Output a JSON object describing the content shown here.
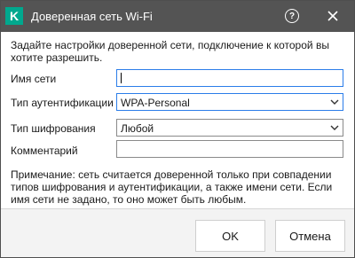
{
  "window": {
    "title": "Доверенная сеть Wi-Fi",
    "logo_letter": "K",
    "help_symbol": "?",
    "accent_color": "#00a88e",
    "titlebar_color": "#545454"
  },
  "intro_text": "Задайте настройки доверенной сети, подключение к которой вы хотите разрешить.",
  "form": {
    "network_name": {
      "label": "Имя сети",
      "value": "",
      "placeholder": ""
    },
    "auth_type": {
      "label": "Тип аутентификации",
      "value": "WPA-Personal"
    },
    "encryption_type": {
      "label": "Тип шифрования",
      "value": "Любой"
    },
    "comment": {
      "label": "Комментарий",
      "value": "",
      "placeholder": ""
    }
  },
  "note_text": "Примечание: сеть считается доверенной только при совпадении типов шифрования и аутентификации, а также имени сети. Если имя сети не задано, то оно может быть любым.",
  "buttons": {
    "ok": "OK",
    "cancel": "Отмена"
  }
}
